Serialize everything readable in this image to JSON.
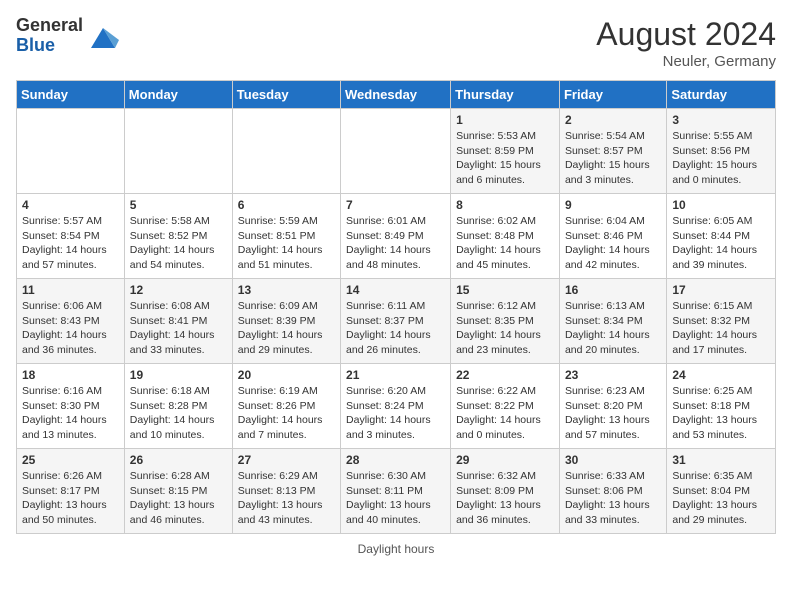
{
  "header": {
    "logo_general": "General",
    "logo_blue": "Blue",
    "month_year": "August 2024",
    "location": "Neuler, Germany"
  },
  "footer": {
    "daylight_label": "Daylight hours"
  },
  "days_of_week": [
    "Sunday",
    "Monday",
    "Tuesday",
    "Wednesday",
    "Thursday",
    "Friday",
    "Saturday"
  ],
  "weeks": [
    [
      {
        "day": "",
        "info": ""
      },
      {
        "day": "",
        "info": ""
      },
      {
        "day": "",
        "info": ""
      },
      {
        "day": "",
        "info": ""
      },
      {
        "day": "1",
        "info": "Sunrise: 5:53 AM\nSunset: 8:59 PM\nDaylight: 15 hours\nand 6 minutes."
      },
      {
        "day": "2",
        "info": "Sunrise: 5:54 AM\nSunset: 8:57 PM\nDaylight: 15 hours\nand 3 minutes."
      },
      {
        "day": "3",
        "info": "Sunrise: 5:55 AM\nSunset: 8:56 PM\nDaylight: 15 hours\nand 0 minutes."
      }
    ],
    [
      {
        "day": "4",
        "info": "Sunrise: 5:57 AM\nSunset: 8:54 PM\nDaylight: 14 hours\nand 57 minutes."
      },
      {
        "day": "5",
        "info": "Sunrise: 5:58 AM\nSunset: 8:52 PM\nDaylight: 14 hours\nand 54 minutes."
      },
      {
        "day": "6",
        "info": "Sunrise: 5:59 AM\nSunset: 8:51 PM\nDaylight: 14 hours\nand 51 minutes."
      },
      {
        "day": "7",
        "info": "Sunrise: 6:01 AM\nSunset: 8:49 PM\nDaylight: 14 hours\nand 48 minutes."
      },
      {
        "day": "8",
        "info": "Sunrise: 6:02 AM\nSunset: 8:48 PM\nDaylight: 14 hours\nand 45 minutes."
      },
      {
        "day": "9",
        "info": "Sunrise: 6:04 AM\nSunset: 8:46 PM\nDaylight: 14 hours\nand 42 minutes."
      },
      {
        "day": "10",
        "info": "Sunrise: 6:05 AM\nSunset: 8:44 PM\nDaylight: 14 hours\nand 39 minutes."
      }
    ],
    [
      {
        "day": "11",
        "info": "Sunrise: 6:06 AM\nSunset: 8:43 PM\nDaylight: 14 hours\nand 36 minutes."
      },
      {
        "day": "12",
        "info": "Sunrise: 6:08 AM\nSunset: 8:41 PM\nDaylight: 14 hours\nand 33 minutes."
      },
      {
        "day": "13",
        "info": "Sunrise: 6:09 AM\nSunset: 8:39 PM\nDaylight: 14 hours\nand 29 minutes."
      },
      {
        "day": "14",
        "info": "Sunrise: 6:11 AM\nSunset: 8:37 PM\nDaylight: 14 hours\nand 26 minutes."
      },
      {
        "day": "15",
        "info": "Sunrise: 6:12 AM\nSunset: 8:35 PM\nDaylight: 14 hours\nand 23 minutes."
      },
      {
        "day": "16",
        "info": "Sunrise: 6:13 AM\nSunset: 8:34 PM\nDaylight: 14 hours\nand 20 minutes."
      },
      {
        "day": "17",
        "info": "Sunrise: 6:15 AM\nSunset: 8:32 PM\nDaylight: 14 hours\nand 17 minutes."
      }
    ],
    [
      {
        "day": "18",
        "info": "Sunrise: 6:16 AM\nSunset: 8:30 PM\nDaylight: 14 hours\nand 13 minutes."
      },
      {
        "day": "19",
        "info": "Sunrise: 6:18 AM\nSunset: 8:28 PM\nDaylight: 14 hours\nand 10 minutes."
      },
      {
        "day": "20",
        "info": "Sunrise: 6:19 AM\nSunset: 8:26 PM\nDaylight: 14 hours\nand 7 minutes."
      },
      {
        "day": "21",
        "info": "Sunrise: 6:20 AM\nSunset: 8:24 PM\nDaylight: 14 hours\nand 3 minutes."
      },
      {
        "day": "22",
        "info": "Sunrise: 6:22 AM\nSunset: 8:22 PM\nDaylight: 14 hours\nand 0 minutes."
      },
      {
        "day": "23",
        "info": "Sunrise: 6:23 AM\nSunset: 8:20 PM\nDaylight: 13 hours\nand 57 minutes."
      },
      {
        "day": "24",
        "info": "Sunrise: 6:25 AM\nSunset: 8:18 PM\nDaylight: 13 hours\nand 53 minutes."
      }
    ],
    [
      {
        "day": "25",
        "info": "Sunrise: 6:26 AM\nSunset: 8:17 PM\nDaylight: 13 hours\nand 50 minutes."
      },
      {
        "day": "26",
        "info": "Sunrise: 6:28 AM\nSunset: 8:15 PM\nDaylight: 13 hours\nand 46 minutes."
      },
      {
        "day": "27",
        "info": "Sunrise: 6:29 AM\nSunset: 8:13 PM\nDaylight: 13 hours\nand 43 minutes."
      },
      {
        "day": "28",
        "info": "Sunrise: 6:30 AM\nSunset: 8:11 PM\nDaylight: 13 hours\nand 40 minutes."
      },
      {
        "day": "29",
        "info": "Sunrise: 6:32 AM\nSunset: 8:09 PM\nDaylight: 13 hours\nand 36 minutes."
      },
      {
        "day": "30",
        "info": "Sunrise: 6:33 AM\nSunset: 8:06 PM\nDaylight: 13 hours\nand 33 minutes."
      },
      {
        "day": "31",
        "info": "Sunrise: 6:35 AM\nSunset: 8:04 PM\nDaylight: 13 hours\nand 29 minutes."
      }
    ]
  ]
}
